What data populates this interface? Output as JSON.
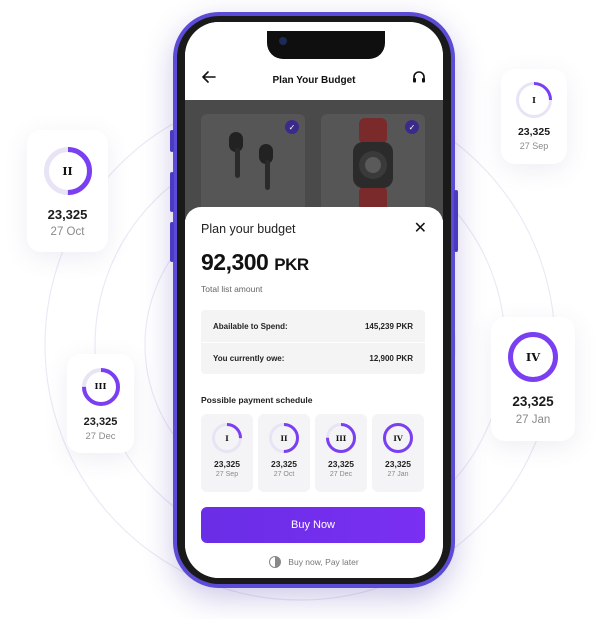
{
  "header": {
    "title": "Plan Your Budget",
    "back_icon": "arrow-left-icon",
    "support_icon": "headphones-icon"
  },
  "products": [
    {
      "name": "airpods",
      "selected": true
    },
    {
      "name": "apple-watch",
      "selected": true
    }
  ],
  "sheet": {
    "title": "Plan your budget",
    "total_amount": "92,300",
    "total_currency": "PKR",
    "total_label": "Total list amount",
    "available_label": "Abailable to Spend:",
    "available_value": "145,239 PKR",
    "owe_label": "You currently owe:",
    "owe_value": "12,900 PKR",
    "schedule_label": "Possible payment schedule",
    "buy_label": "Buy Now",
    "bnpl_label": "Buy now, Pay later"
  },
  "schedule": [
    {
      "numeral": "I",
      "amount": "23,325",
      "date": "27 Sep",
      "progress": 0.25
    },
    {
      "numeral": "II",
      "amount": "23,325",
      "date": "27 Oct",
      "progress": 0.5
    },
    {
      "numeral": "III",
      "amount": "23,325",
      "date": "27 Dec",
      "progress": 0.75
    },
    {
      "numeral": "IV",
      "amount": "23,325",
      "date": "27 Jan",
      "progress": 1.0
    }
  ],
  "floating_cards": {
    "ii": {
      "numeral": "II",
      "amount": "23,325",
      "date": "27 Oct",
      "progress": 0.5
    },
    "i": {
      "numeral": "I",
      "amount": "23,325",
      "date": "27 Sep",
      "progress": 0.25
    },
    "iii": {
      "numeral": "III",
      "amount": "23,325",
      "date": "27 Dec",
      "progress": 0.75
    },
    "iv": {
      "numeral": "IV",
      "amount": "23,325",
      "date": "27 Jan",
      "progress": 1.0
    }
  },
  "colors": {
    "accent": "#7b3ff2",
    "ring_track": "#e8e4f6",
    "phone_frame": "#5b4bd6"
  }
}
